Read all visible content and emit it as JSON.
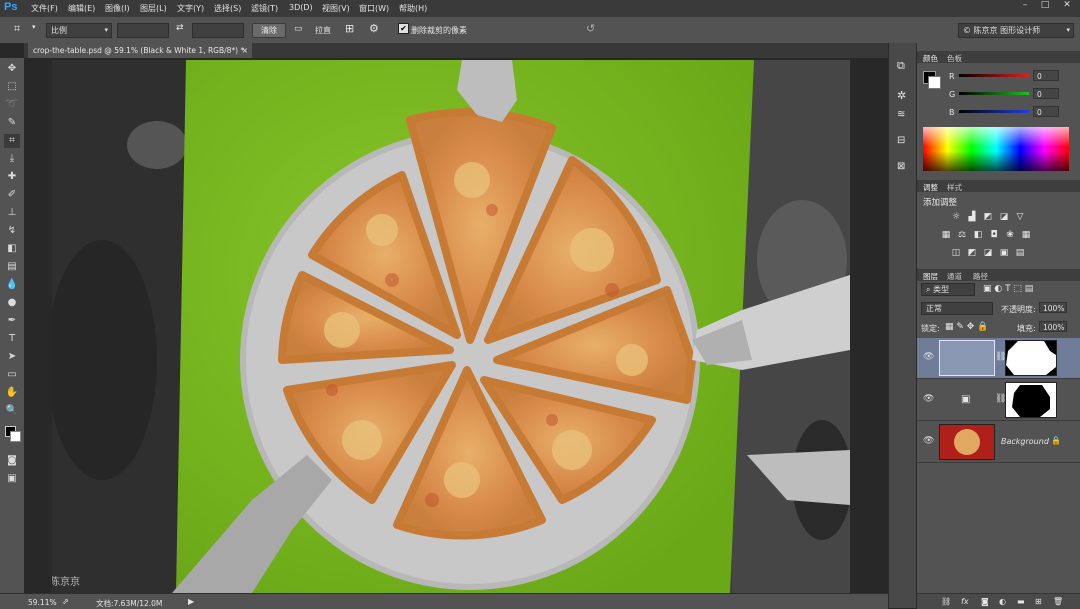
{
  "app": {
    "logo": "Ps"
  },
  "menu": [
    "文件(F)",
    "编辑(E)",
    "图像(I)",
    "图层(L)",
    "文字(Y)",
    "选择(S)",
    "滤镜(T)",
    "3D(D)",
    "视图(V)",
    "窗口(W)",
    "帮助(H)"
  ],
  "window_controls": [
    "–",
    "□",
    "✕"
  ],
  "options": {
    "ratio_select": "比例",
    "clear_button": "清除",
    "straighten_label": "拉直",
    "delete_cropped_label": "删除裁剪的像素",
    "delete_cropped_checked": true,
    "workspace_select": "© 陈京京 图形设计师"
  },
  "document_tab": "crop-the-table.psd @ 59.1% (Black & White 1, RGB/8*) *",
  "watermark": "©陈京京",
  "status": {
    "zoom": "59.11%",
    "doc_info": "文档:7.63M/12.0M"
  },
  "color_panel": {
    "tabs": [
      "颜色",
      "色板"
    ],
    "channels": [
      {
        "label": "R",
        "value": "0",
        "color": "#e02020"
      },
      {
        "label": "G",
        "value": "0",
        "color": "#20c020"
      },
      {
        "label": "B",
        "value": "0",
        "color": "#2040e0"
      }
    ]
  },
  "adjustments_panel": {
    "tabs": [
      "调整",
      "样式"
    ],
    "title": "添加调整",
    "row1": [
      "brightness-icon",
      "levels-icon",
      "curves-icon",
      "exposure-icon",
      "vibrance-icon"
    ],
    "row2": [
      "hue-icon",
      "balance-icon",
      "bw-icon",
      "photo-filter-icon",
      "channel-mixer-icon",
      "color-lookup-icon"
    ],
    "row3": [
      "invert-icon",
      "posterize-icon",
      "threshold-icon",
      "selective-color-icon",
      "gradient-map-icon"
    ]
  },
  "layers_panel": {
    "tabs": [
      "图层",
      "通道",
      "路径"
    ],
    "filter_select": "类型",
    "blend_mode": "正常",
    "opacity_label": "不透明度:",
    "opacity_value": "100%",
    "lock_label": "锁定:",
    "fill_label": "填充:",
    "fill_value": "100%",
    "layers": [
      {
        "name": "",
        "type": "adjustment",
        "selected": true
      },
      {
        "name": "",
        "type": "adjustment",
        "selected": false
      },
      {
        "name": "Background",
        "type": "image",
        "selected": false
      }
    ]
  }
}
